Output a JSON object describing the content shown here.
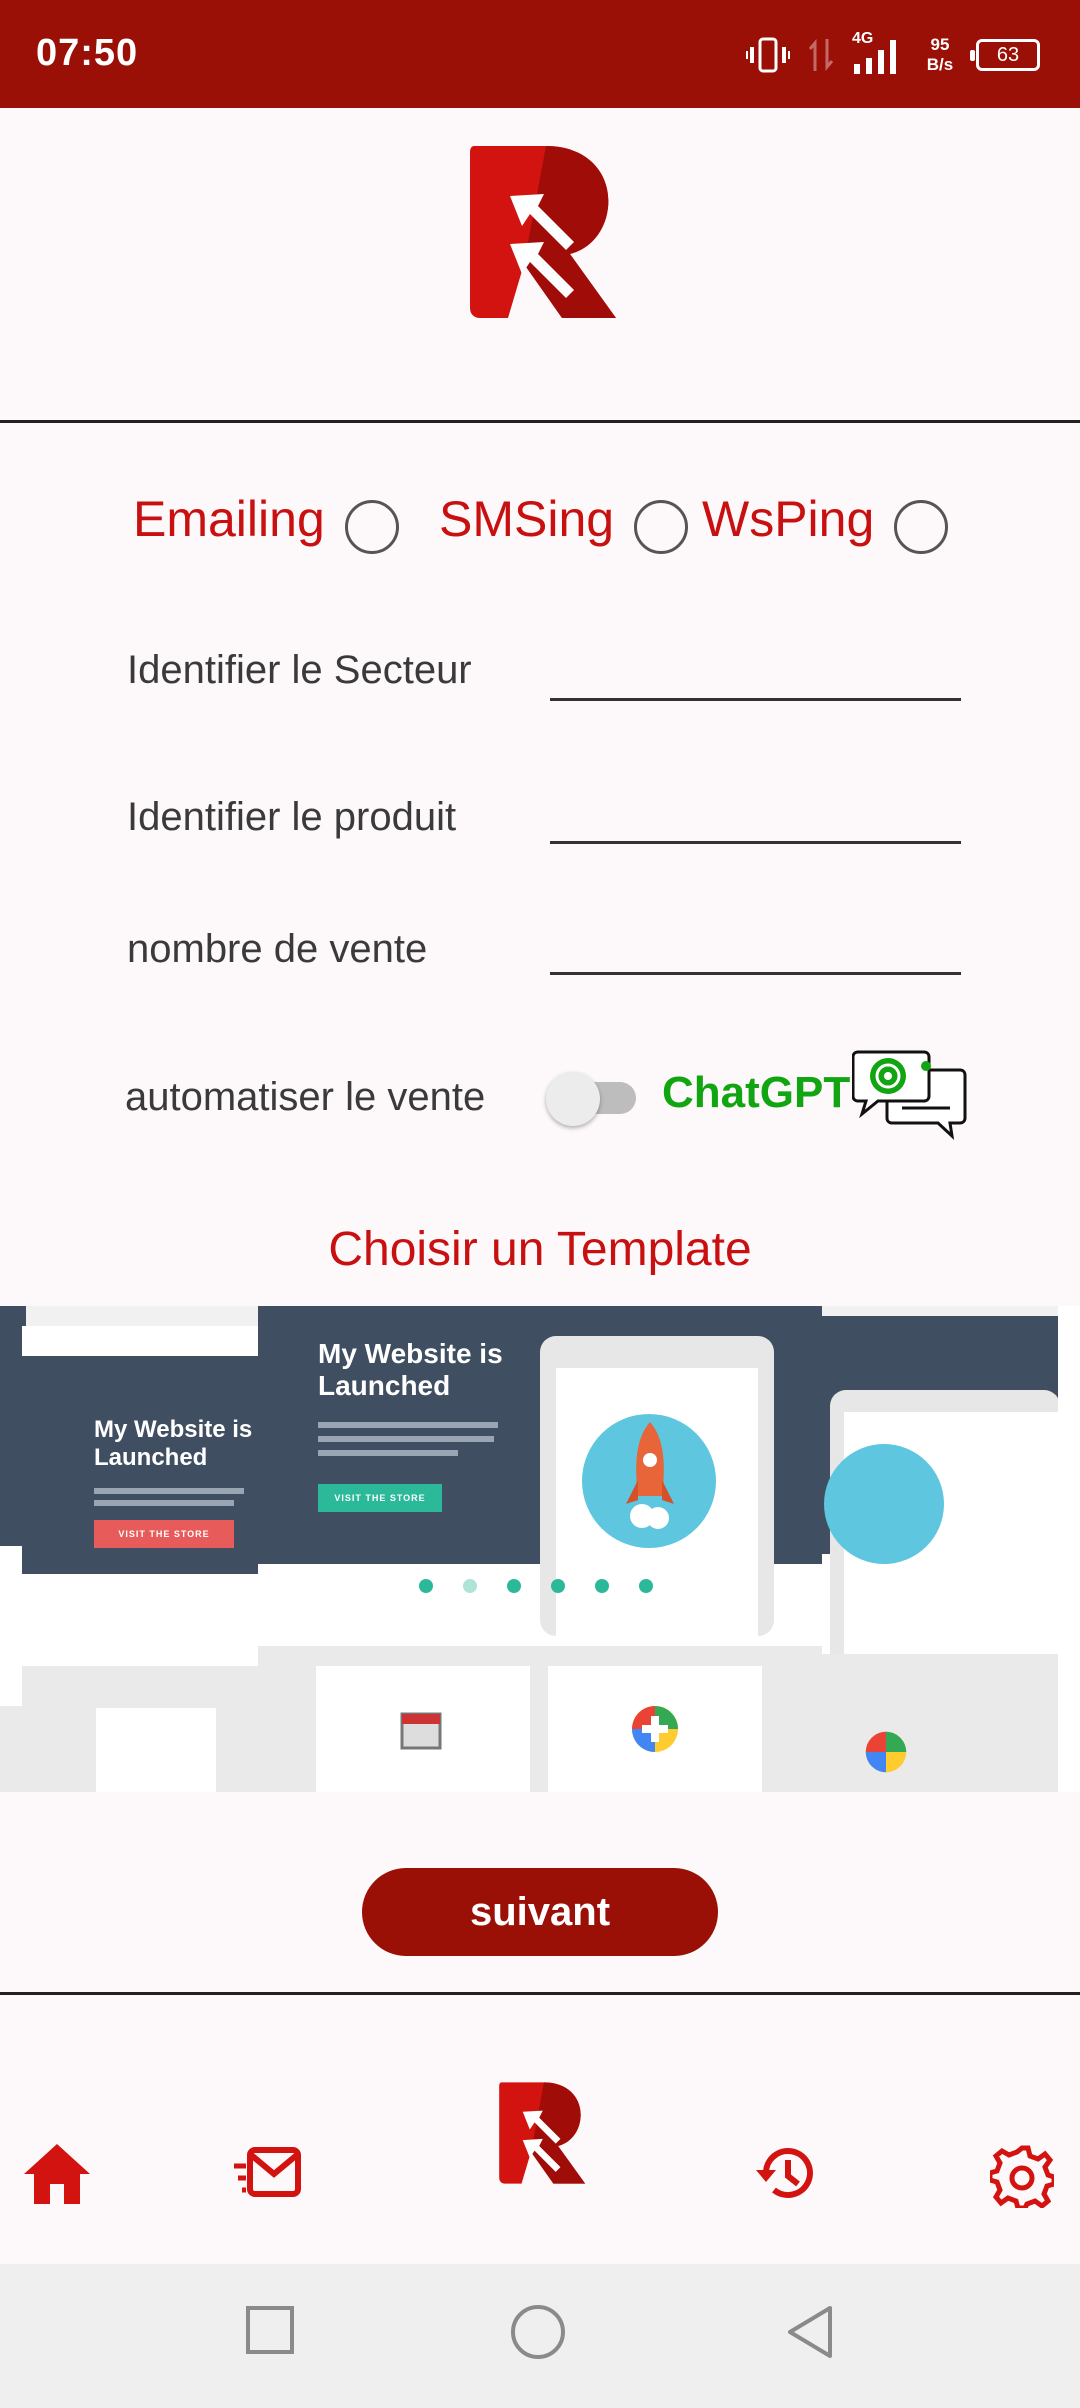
{
  "status_bar": {
    "time": "07:50",
    "network": "4G",
    "speed_value": "95",
    "speed_unit": "B/s",
    "battery": "63"
  },
  "channels": [
    {
      "label": "Emailing",
      "checked": false
    },
    {
      "label": "SMSing",
      "checked": false
    },
    {
      "label": "WsPing",
      "checked": false
    }
  ],
  "form": {
    "sector_label": "Identifier le Secteur",
    "sector_value": "",
    "product_label": "Identifier le produit",
    "product_value": "",
    "sales_count_label": "nombre de vente",
    "sales_count_value": "",
    "automate_label": "automatiser le vente",
    "automate_on": false,
    "chatgpt_label": "ChatGPT"
  },
  "template_section": {
    "title": "Choisir un Template",
    "preview_headline": "My Website is Launched",
    "preview_button": "VISIT THE STORE"
  },
  "next_button": "suivant",
  "bottom_nav": [
    "home-icon",
    "mail-icon",
    "app-logo",
    "history-icon",
    "settings-icon"
  ],
  "colors": {
    "brand_dark_red": "#9a0f06",
    "accent_red": "#c81010",
    "chatgpt_green": "#12a512",
    "template_green": "#2bb99a",
    "template_red": "#e85b5b"
  }
}
